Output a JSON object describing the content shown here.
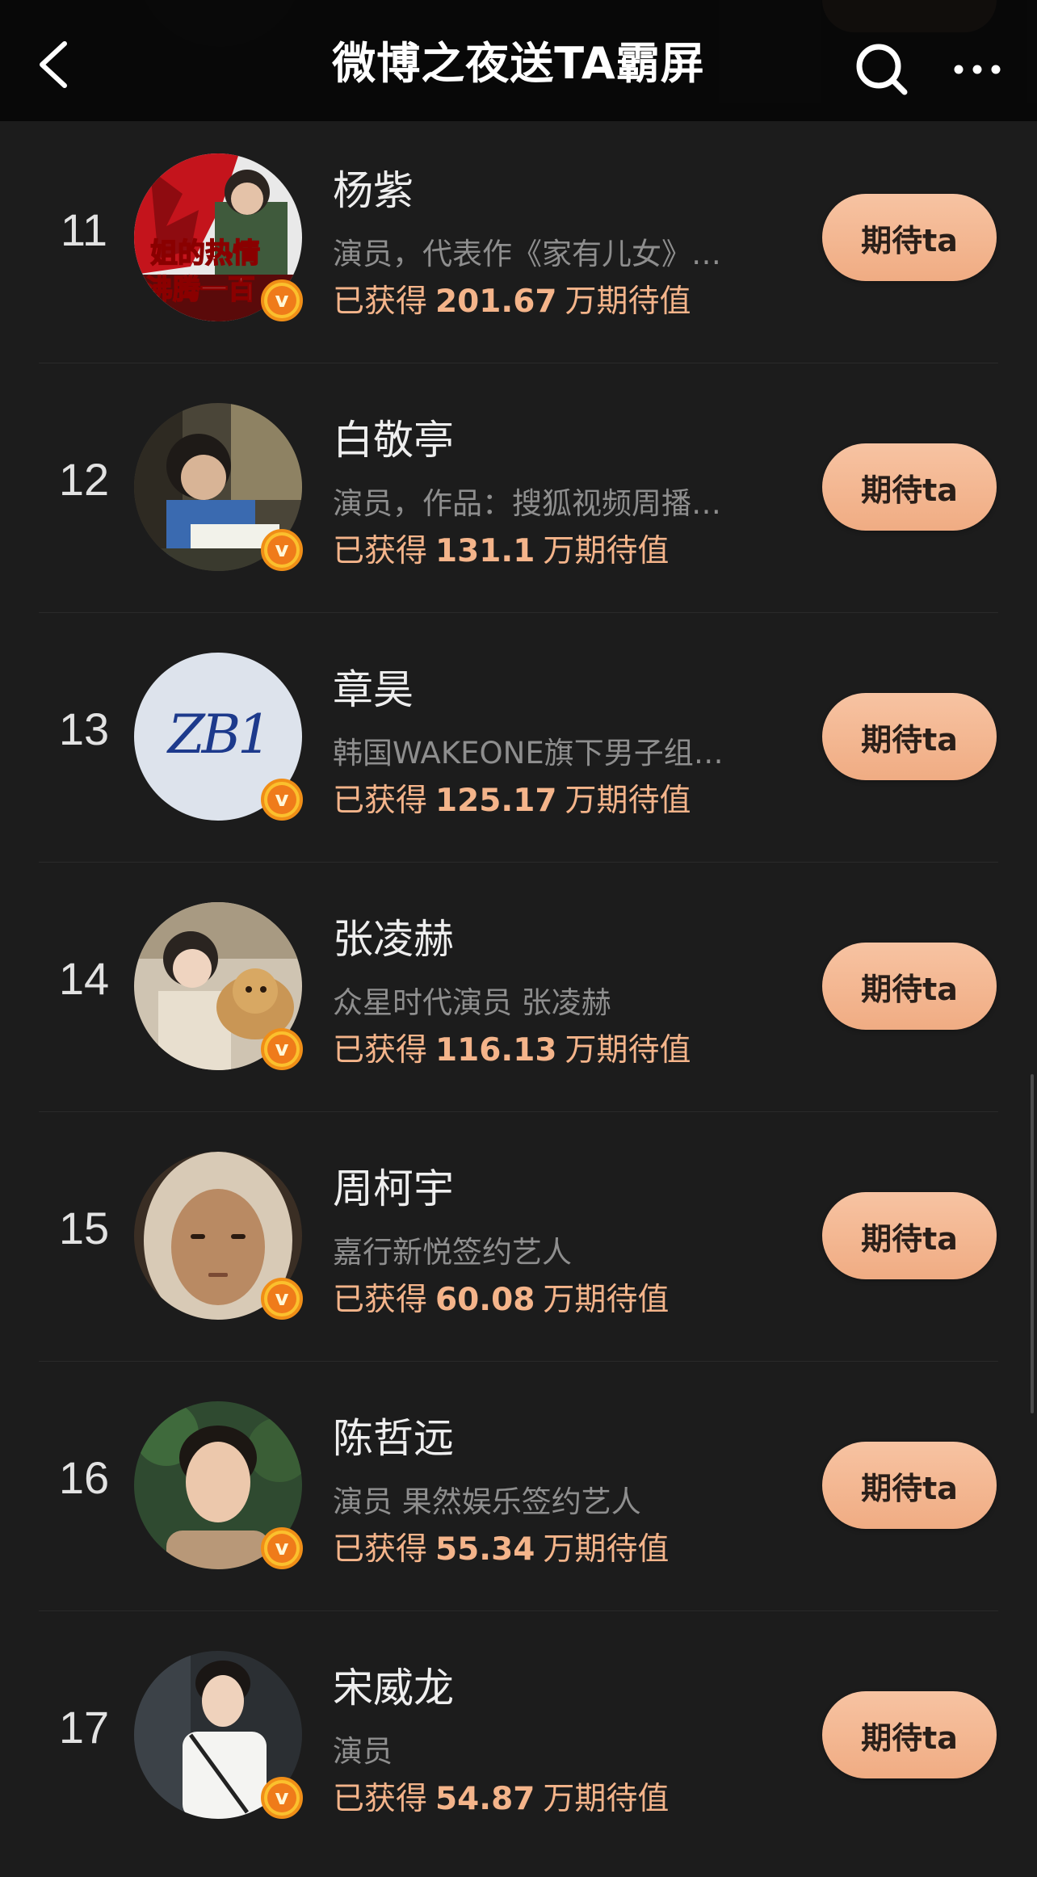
{
  "nav": {
    "title": "微博之夜送TA霸屏",
    "back_icon": "chevron-left-icon",
    "search_icon": "search-icon",
    "more_icon": "more-dots-icon"
  },
  "colors": {
    "background": "#1c1c1c",
    "accent_text": "#f4b48a",
    "button_bg": "#f0ac83",
    "verified_badge": "#f08e17"
  },
  "list": {
    "items": [
      {
        "rank": "11",
        "name": "杨紫",
        "desc": "演员，代表作《家有儿女》…",
        "score_prefix": "已获得",
        "score": "201.67",
        "score_suffix": "万期待值",
        "button": "期待ta",
        "avatar_text_1": "姐的热情",
        "avatar_text_2": "沸腾一百"
      },
      {
        "rank": "12",
        "name": "白敬亭",
        "desc": "演员，作品：搜狐视频周播…",
        "score_prefix": "已获得",
        "score": "131.1",
        "score_suffix": "万期待值",
        "button": "期待ta"
      },
      {
        "rank": "13",
        "name": "章昊",
        "desc": "韩国WAKEONE旗下男子组…",
        "score_prefix": "已获得",
        "score": "125.17",
        "score_suffix": "万期待值",
        "button": "期待ta",
        "avatar_logo": "ZB1"
      },
      {
        "rank": "14",
        "name": "张凌赫",
        "desc": "众星时代演员 张凌赫",
        "score_prefix": "已获得",
        "score": "116.13",
        "score_suffix": "万期待值",
        "button": "期待ta"
      },
      {
        "rank": "15",
        "name": "周柯宇",
        "desc": "嘉行新悦签约艺人",
        "score_prefix": "已获得",
        "score": "60.08",
        "score_suffix": "万期待值",
        "button": "期待ta"
      },
      {
        "rank": "16",
        "name": "陈哲远",
        "desc": "演员 果然娱乐签约艺人",
        "score_prefix": "已获得",
        "score": "55.34",
        "score_suffix": "万期待值",
        "button": "期待ta"
      },
      {
        "rank": "17",
        "name": "宋威龙",
        "desc": "演员",
        "score_prefix": "已获得",
        "score": "54.87",
        "score_suffix": "万期待值",
        "button": "期待ta"
      }
    ]
  }
}
